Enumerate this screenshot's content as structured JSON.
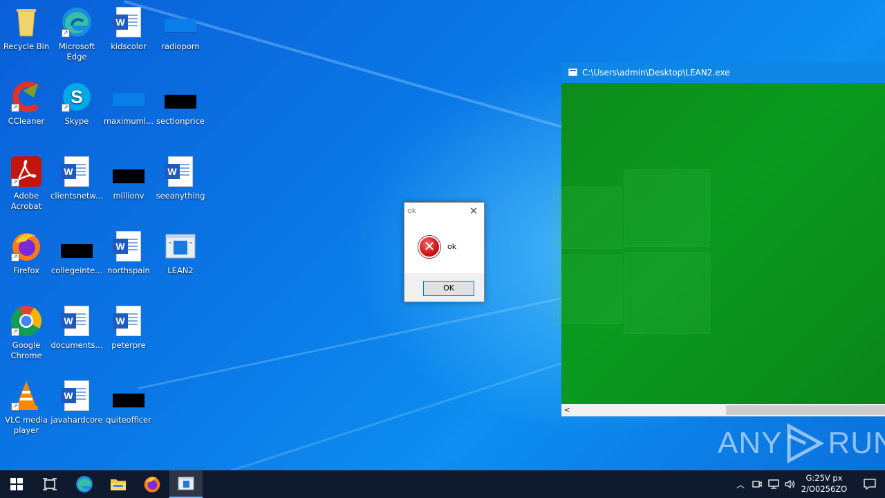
{
  "desktop": {
    "icons": [
      {
        "label": "Recycle Bin",
        "icon": "recycle-bin-icon"
      },
      {
        "label": "Microsoft Edge",
        "icon": "edge-icon"
      },
      {
        "label": "kidscolor",
        "icon": "word-document-icon"
      },
      {
        "label": "radioporn",
        "icon": "blue-file-icon"
      },
      {
        "label": "CCleaner",
        "icon": "ccleaner-icon"
      },
      {
        "label": "Skype",
        "icon": "skype-icon"
      },
      {
        "label": "maximuml...",
        "icon": "blue-file-icon"
      },
      {
        "label": "sectionprice",
        "icon": "black-file-icon"
      },
      {
        "label": "Adobe Acrobat",
        "icon": "adobe-acrobat-icon"
      },
      {
        "label": "clientsnetw...",
        "icon": "word-document-icon"
      },
      {
        "label": "millionv",
        "icon": "black-file-icon"
      },
      {
        "label": "seeanything",
        "icon": "word-document-icon"
      },
      {
        "label": "Firefox",
        "icon": "firefox-icon"
      },
      {
        "label": "collegeinte...",
        "icon": "black-file-icon"
      },
      {
        "label": "northspain",
        "icon": "word-document-icon"
      },
      {
        "label": "LEAN2",
        "icon": "exe-app-icon"
      },
      {
        "label": "Google Chrome",
        "icon": "chrome-icon"
      },
      {
        "label": "documents...",
        "icon": "word-document-icon"
      },
      {
        "label": "peterpre",
        "icon": "word-document-icon"
      },
      {
        "label": "VLC media player",
        "icon": "vlc-icon"
      },
      {
        "label": "javahardcore",
        "icon": "word-document-icon"
      },
      {
        "label": "quiteofficer",
        "icon": "black-file-icon"
      }
    ]
  },
  "lean_window": {
    "title": "C:\\Users\\admin\\Desktop\\LEAN2.exe",
    "body_color": "#0a9a20"
  },
  "dialog": {
    "title": "ok",
    "message": "ok",
    "ok_label": "OK",
    "icon": "error-icon"
  },
  "watermark": {
    "left": "ANY",
    "right": "RUN"
  },
  "taskbar": {
    "pinned": [
      "windows-start-icon",
      "task-view-icon",
      "edge-icon",
      "file-explorer-icon",
      "firefox-icon",
      "lean2-app-icon"
    ],
    "clock_time": "G:25V px",
    "clock_date": "2/O0256ZO"
  },
  "colors": {
    "taskbar": "#101a2e",
    "window_titlebar": "#0e86e6",
    "accent": "#0078d7"
  }
}
